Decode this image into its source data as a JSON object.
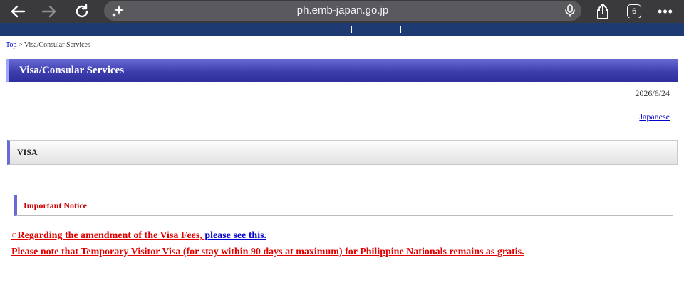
{
  "browser": {
    "url": "ph.emb-japan.go.jp",
    "tab_count": "6",
    "more_label": "•••"
  },
  "breadcrumb": {
    "top_link": "Top",
    "separator": " > ",
    "current": "Visa/Consular Services"
  },
  "page": {
    "title": "Visa/Consular Services",
    "date": "2026/6/24",
    "language_link": "Japanese"
  },
  "section": {
    "title": "VISA"
  },
  "notice": {
    "heading": "Important Notice",
    "line1_red": "○Regarding the amendment of the Visa Fees, ",
    "line1_link": "please see this.",
    "line2": "Please note that Temporary Visitor Visa (for stay within 90 days at maximum) for Philippine Nationals remains as gratis."
  },
  "colors": {
    "toolbar": "#3a3a3c",
    "site_nav": "#1d3a73",
    "title_bar": "#3d3dae",
    "notice_red": "#e00000",
    "link_blue": "#0000cc"
  },
  "icons": [
    "back-arrow-icon",
    "forward-arrow-icon",
    "reload-icon",
    "sparkle-icon",
    "microphone-icon",
    "share-icon",
    "tabs-icon",
    "more-icon"
  ]
}
